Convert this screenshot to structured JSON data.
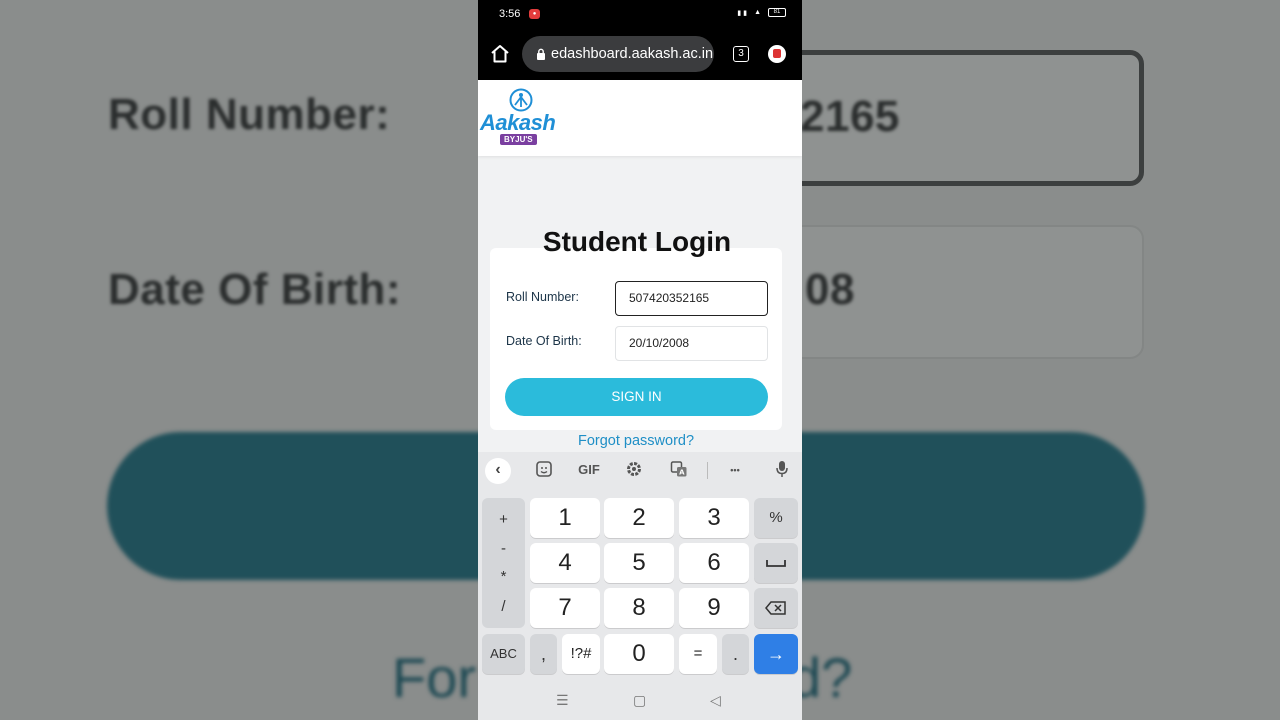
{
  "backdrop": {
    "roll_label": "Roll Number:",
    "roll_value": "2165",
    "dob_label": "Date Of Birth:",
    "dob_value": "08",
    "forgot_left": "For",
    "forgot_right": "d?"
  },
  "status_bar": {
    "time": "3:56",
    "battery": "81"
  },
  "browser": {
    "url": "edashboard.aakash.ac.in",
    "tab_count": "3"
  },
  "site": {
    "logo_text": "Aakash",
    "logo_badge": "BYJU'S"
  },
  "login": {
    "title": "Student Login",
    "roll_label": "Roll Number:",
    "roll_value": "507420352165",
    "dob_label": "Date Of Birth:",
    "dob_value": "20/10/2008",
    "signin_label": "SIGN IN",
    "forgot_label": "Forgot password?"
  },
  "keyboard": {
    "toolbar": {
      "gif": "GIF",
      "more": "•••"
    },
    "symbols": [
      "+",
      "-",
      "*",
      "/"
    ],
    "digits": [
      "1",
      "2",
      "3",
      "4",
      "5",
      "6",
      "7",
      "8",
      "9",
      "0"
    ],
    "percent": "%",
    "abc": "ABC",
    "comma": ",",
    "sym": "!?#",
    "equals": "=",
    "period": ".",
    "enter": "→"
  },
  "nav": {
    "recents": "☰",
    "home": "▢",
    "back": "◁"
  }
}
